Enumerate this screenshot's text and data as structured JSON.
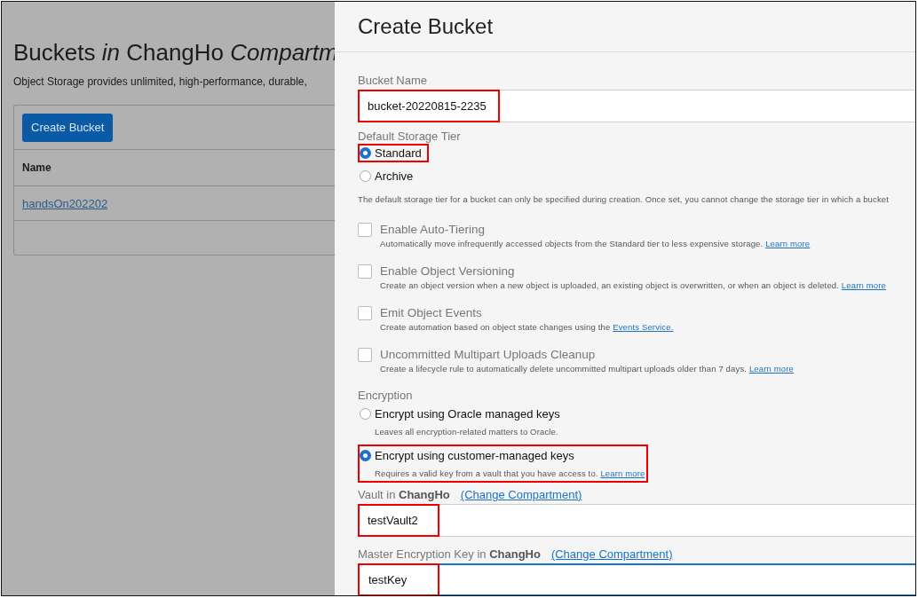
{
  "page": {
    "title": "Buckets *in* ChangHo *Compartm*",
    "description": "Object Storage provides unlimited, high-performance, durable,",
    "create_button": "Create Bucket",
    "table": {
      "columns": [
        "Name"
      ],
      "rows": [
        [
          "handsOn202202"
        ]
      ]
    }
  },
  "panel": {
    "title": "Create Bucket",
    "bucket_name": {
      "label": "Bucket Name",
      "value": "bucket-20220815-2235",
      "highlighted": true,
      "focused": false
    },
    "storage_tier": {
      "label": "Default Storage Tier",
      "options": [
        {
          "label": "Standard",
          "selected": true,
          "highlighted": true
        },
        {
          "label": "Archive",
          "selected": false,
          "highlighted": false
        }
      ],
      "help": "The default storage tier for a bucket can only be specified during creation. Once set, you cannot change the storage tier in which a bucket"
    },
    "checkboxes": [
      {
        "label": "Enable Auto-Tiering",
        "checked": false,
        "description": "Automatically move infrequently accessed objects from the Standard tier to less expensive storage.",
        "link": "Learn more"
      },
      {
        "label": "Enable Object Versioning",
        "checked": false,
        "description": "Create an object version when a new object is uploaded, an existing object is overwritten, or when an object is deleted.",
        "link": "Learn more"
      },
      {
        "label": "Emit Object Events",
        "checked": false,
        "description": "Create automation based on object state changes using the",
        "link": "Events Service."
      },
      {
        "label": "Uncommitted Multipart Uploads Cleanup",
        "checked": false,
        "description": "Create a lifecycle rule to automatically delete uncommitted multipart uploads older than 7 days.",
        "link": "Learn more"
      }
    ],
    "encryption": {
      "label": "Encryption",
      "options": [
        {
          "label": "Encrypt using Oracle managed keys",
          "description": "Leaves all encryption-related matters to Oracle.",
          "selected": false,
          "highlighted": false
        },
        {
          "label": "Encrypt using customer-managed keys",
          "description": "Requires a valid key from a vault that you have access to.",
          "link": "Learn more",
          "selected": true,
          "highlighted": true
        }
      ]
    },
    "key_fields": [
      {
        "label": "Vault in **ChangHo**",
        "link": "(Change Compartment)",
        "value": "testVault2",
        "highlighted": true,
        "focused": false
      },
      {
        "label": "Master Encryption Key in **ChangHo**",
        "link": "(Change Compartment)",
        "value": "testKey",
        "highlighted": true,
        "focused": true
      }
    ]
  }
}
